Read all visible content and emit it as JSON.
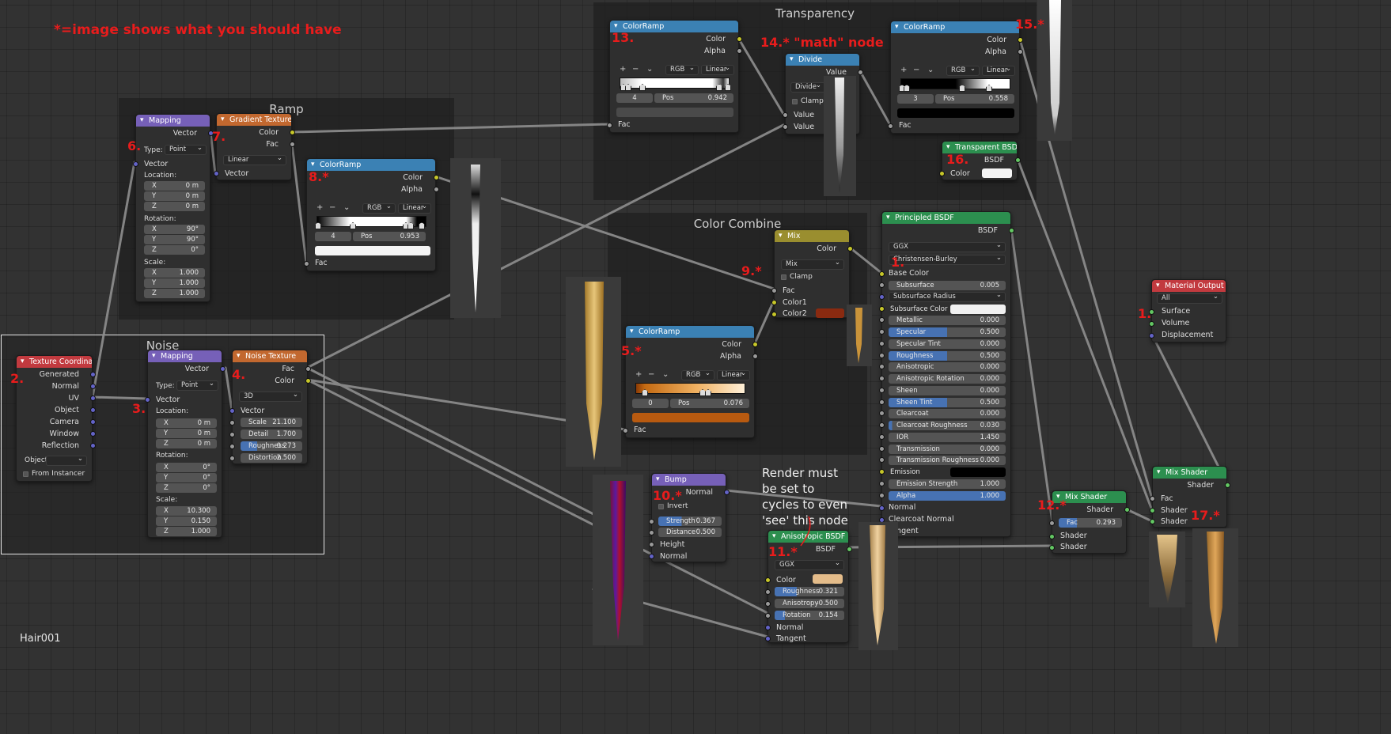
{
  "annotations": {
    "note_top": "*=image shows what you should have",
    "note_render": "Render must be set to cycles to even 'see' this node",
    "n1": "1.",
    "n1b": "1.",
    "n2": "2.",
    "n3": "3.",
    "n4": "4.",
    "n5": "5.*",
    "n6": "6.",
    "n7": "7.",
    "n8": "8.*",
    "n9": "9.*",
    "n10": "10.*",
    "n11": "11.*",
    "n12": "12.*",
    "n13": "13.",
    "n14": "14.* \"math\" node",
    "n15": "15.*",
    "n16": "16.",
    "n17": "17.*",
    "material_name": "Hair001"
  },
  "frames": {
    "ramp": "Ramp",
    "noise": "Noise",
    "transparency": "Transparency",
    "color_combine": "Color Combine"
  },
  "texcoord": {
    "title": "Texture Coordinate",
    "outputs": [
      "Generated",
      "Normal",
      "UV",
      "Object",
      "Camera",
      "Window",
      "Reflection"
    ],
    "object_label": "Object:",
    "from_instancer": "From Instancer"
  },
  "mapping2": {
    "title": "Mapping",
    "vector_out": "Vector",
    "type_label": "Type:",
    "type": "Point",
    "vector_in": "Vector",
    "location": "Location:",
    "loc": [
      {
        "a": "X",
        "v": "0 m"
      },
      {
        "a": "Y",
        "v": "0 m"
      },
      {
        "a": "Z",
        "v": "0 m"
      }
    ],
    "rotation": "Rotation:",
    "rot": [
      {
        "a": "X",
        "v": "0°"
      },
      {
        "a": "Y",
        "v": "0°"
      },
      {
        "a": "Z",
        "v": "0°"
      }
    ],
    "scale": "Scale:",
    "scl": [
      {
        "a": "X",
        "v": "10.300"
      },
      {
        "a": "Y",
        "v": "0.150"
      },
      {
        "a": "Z",
        "v": "1.000"
      }
    ]
  },
  "noise": {
    "title": "Noise Texture",
    "fac": "Fac",
    "color": "Color",
    "dim": "3D",
    "vector": "Vector",
    "fields": [
      {
        "l": "Scale",
        "v": "21.100"
      },
      {
        "l": "Detail",
        "v": "1.700"
      },
      {
        "l": "Roughness",
        "v": "0.273"
      },
      {
        "l": "Distortion",
        "v": "2.500"
      }
    ]
  },
  "mapping1": {
    "title": "Mapping",
    "vector_out": "Vector",
    "type_label": "Type:",
    "type": "Point",
    "vector_in": "Vector",
    "location": "Location:",
    "loc": [
      {
        "a": "X",
        "v": "0 m"
      },
      {
        "a": "Y",
        "v": "0 m"
      },
      {
        "a": "Z",
        "v": "0 m"
      }
    ],
    "rotation": "Rotation:",
    "rot": [
      {
        "a": "X",
        "v": "90°"
      },
      {
        "a": "Y",
        "v": "90°"
      },
      {
        "a": "Z",
        "v": "0°"
      }
    ],
    "scale": "Scale:",
    "scl": [
      {
        "a": "X",
        "v": "1.000"
      },
      {
        "a": "Y",
        "v": "1.000"
      },
      {
        "a": "Z",
        "v": "1.000"
      }
    ]
  },
  "gradient": {
    "title": "Gradient Texture",
    "color": "Color",
    "fac": "Fac",
    "type": "Linear",
    "vector": "Vector"
  },
  "ramp8": {
    "title": "ColorRamp",
    "color": "Color",
    "alpha": "Alpha",
    "mode": "RGB",
    "interp": "Linear",
    "index": "4",
    "pos_label": "Pos",
    "pos": "0.953",
    "fac": "Fac"
  },
  "ramp5": {
    "title": "ColorRamp",
    "color": "Color",
    "alpha": "Alpha",
    "mode": "RGB",
    "interp": "Linear",
    "index": "0",
    "pos_label": "Pos",
    "pos": "0.076",
    "fac": "Fac"
  },
  "ramp13": {
    "title": "ColorRamp",
    "color": "Color",
    "alpha": "Alpha",
    "mode": "RGB",
    "interp": "Linear",
    "index": "4",
    "pos_label": "Pos",
    "pos": "0.942",
    "fac": "Fac"
  },
  "ramp15": {
    "title": "ColorRamp",
    "color": "Color",
    "alpha": "Alpha",
    "mode": "RGB",
    "interp": "Linear",
    "index": "3",
    "pos_label": "Pos",
    "pos": "0.558",
    "fac": "Fac"
  },
  "divide": {
    "title": "Divide",
    "value_out": "Value",
    "op": "Divide",
    "clamp": "Clamp",
    "value1": "Value",
    "value2": "Value"
  },
  "transparent": {
    "title": "Transparent BSDF",
    "bsdf": "BSDF",
    "color": "Color"
  },
  "mix": {
    "title": "Mix",
    "color": "Color",
    "mode": "Mix",
    "clamp": "Clamp",
    "fac": "Fac",
    "color1": "Color1",
    "color2": "Color2"
  },
  "principled": {
    "title": "Principled BSDF",
    "bsdf": "BSDF",
    "dist": "GGX",
    "sss": "Christensen-Burley",
    "base_color": "Base Color",
    "rows": [
      {
        "l": "Subsurface",
        "v": "0.005"
      },
      {
        "l": "Subsurface Radius",
        "dd": true
      },
      {
        "l": "Subsurface Color",
        "sw": "#f0f0f0"
      },
      {
        "l": "Metallic",
        "v": "0.000"
      },
      {
        "l": "Specular",
        "v": "0.500",
        "p": "50%"
      },
      {
        "l": "Specular Tint",
        "v": "0.000"
      },
      {
        "l": "Roughness",
        "v": "0.500",
        "p": "50%"
      },
      {
        "l": "Anisotropic",
        "v": "0.000"
      },
      {
        "l": "Anisotropic Rotation",
        "v": "0.000"
      },
      {
        "l": "Sheen",
        "v": "0.000"
      },
      {
        "l": "Sheen Tint",
        "v": "0.500",
        "p": "50%"
      },
      {
        "l": "Clearcoat",
        "v": "0.000"
      },
      {
        "l": "Clearcoat Roughness",
        "v": "0.030",
        "p": "3%"
      },
      {
        "l": "IOR",
        "v": "1.450"
      },
      {
        "l": "Transmission",
        "v": "0.000"
      },
      {
        "l": "Transmission Roughness",
        "v": "0.000"
      },
      {
        "l": "Emission",
        "sw": "#000000"
      },
      {
        "l": "Emission Strength",
        "v": "1.000"
      },
      {
        "l": "Alpha",
        "v": "1.000",
        "p": "100%"
      }
    ],
    "normal": "Normal",
    "clearcoat_normal": "Clearcoat Normal",
    "tangent": "Tangent"
  },
  "material_output": {
    "title": "Material Output",
    "target": "All",
    "surface": "Surface",
    "volume": "Volume",
    "displacement": "Displacement"
  },
  "mix_shader_12": {
    "title": "Mix Shader",
    "shader": "Shader",
    "fac_label": "Fac",
    "fac": "0.293",
    "in1": "Shader",
    "in2": "Shader"
  },
  "mix_shader_17": {
    "title": "Mix Shader",
    "shader": "Shader",
    "fac": "Fac",
    "in1": "Shader",
    "in2": "Shader"
  },
  "bump": {
    "title": "Bump",
    "normal_out": "Normal",
    "invert": "Invert",
    "strength_label": "Strength",
    "strength": "0.367",
    "distance_label": "Distance",
    "distance": "0.500",
    "height": "Height",
    "normal_in": "Normal"
  },
  "aniso": {
    "title": "Anisotropic BSDF",
    "bsdf": "BSDF",
    "dist": "GGX",
    "color": "Color",
    "roughness_label": "Roughness",
    "roughness": "0.321",
    "anisotropy_label": "Anisotropy",
    "anisotropy": "-0.500",
    "rotation_label": "Rotation",
    "rotation": "0.154",
    "normal": "Normal",
    "tangent": "Tangent"
  },
  "colors": {
    "ramp_header": "#3b81b4",
    "mapping_header": "#7660b8",
    "texture_header": "#c2682f",
    "input_header": "#c23a3f",
    "shader_header": "#2c8f4f",
    "mix_header": "#9a8e2f",
    "annotation_red": "#e81c1c",
    "link": "#8f8f8f"
  }
}
